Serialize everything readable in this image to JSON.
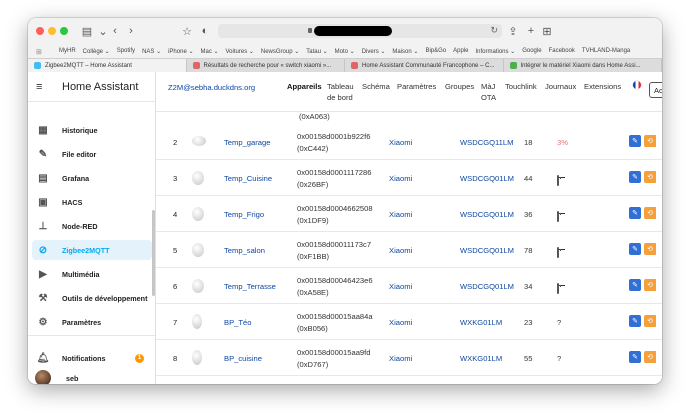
{
  "browser": {
    "bookmarks": [
      "MyHR",
      "Collège ⌄",
      "Spotify",
      "NAS ⌄",
      "iPhone ⌄",
      "Mac ⌄",
      "Voitures ⌄",
      "NewsGroup ⌄",
      "Tatau ⌄",
      "Moto ⌄",
      "Divers ⌄",
      "Maison ⌄",
      "Bip&Go",
      "Apple",
      "Informations ⌄",
      "Google",
      "Facebook",
      "TVHLAND-Manga"
    ],
    "tabs": [
      {
        "label": "Zigbee2MQTT – Home Assistant",
        "color": "#41bdf5"
      },
      {
        "label": "Résultats de recherche pour « switch xiaomi »...",
        "color": "#e06666"
      },
      {
        "label": "Home Assistant Communauté Francophone – C...",
        "color": "#e06666"
      },
      {
        "label": "Intégrer le matériel Xiaomi dans Home Assi...",
        "color": "#4caf50"
      }
    ]
  },
  "sidebar": {
    "title": "Home Assistant",
    "items": [
      {
        "label": "Historique",
        "icon": "history-icon"
      },
      {
        "label": "File editor",
        "icon": "wrench-icon"
      },
      {
        "label": "Grafana",
        "icon": "chart-icon"
      },
      {
        "label": "HACS",
        "icon": "hacs-icon"
      },
      {
        "label": "Node-RED",
        "icon": "sitemap-icon"
      },
      {
        "label": "Zigbee2MQTT",
        "icon": "zigbee-icon"
      },
      {
        "label": "Multimédia",
        "icon": "media-icon"
      },
      {
        "label": "Outils de développement",
        "icon": "hammer-icon"
      },
      {
        "label": "Paramètres",
        "icon": "gear-icon"
      }
    ],
    "notifications": {
      "label": "Notifications",
      "count": "1"
    },
    "user": {
      "label": "seb"
    }
  },
  "topbar": {
    "host": "Z2M@sebha.duckdns.org",
    "nav": [
      "Appareils",
      "Tableau de bord",
      "Schéma",
      "Paramètres",
      "Groupes",
      "MàJ OTA",
      "Touchlink",
      "Journaux",
      "Extensions"
    ],
    "active_nav": "Appareils",
    "button_label": "Activer l'ap"
  },
  "table": {
    "partial_text": "(0xA063)",
    "rows": [
      {
        "num": "2",
        "name": "Temp_garage",
        "ieee": "0x00158d0001b922f6",
        "nwk": "(0xC442)",
        "vendor": "Xiaomi",
        "model": "WSDCGQ11LM",
        "lqi": "18",
        "battery": "3%",
        "battery_level": 0.03
      },
      {
        "num": "3",
        "name": "Temp_Cuisine",
        "ieee": "0x00158d0001117286",
        "nwk": "(0x26BF)",
        "vendor": "Xiaomi",
        "model": "WSDCGQ01LM",
        "lqi": "44",
        "battery": "",
        "battery_level": 0.8
      },
      {
        "num": "4",
        "name": "Temp_Frigo",
        "ieee": "0x00158d0004662508",
        "nwk": "(0x1DF9)",
        "vendor": "Xiaomi",
        "model": "WSDCGQ01LM",
        "lqi": "36",
        "battery": "",
        "battery_level": 0.8
      },
      {
        "num": "5",
        "name": "Temp_salon",
        "ieee": "0x00158d00011173c7",
        "nwk": "(0xF1BB)",
        "vendor": "Xiaomi",
        "model": "WSDCGQ01LM",
        "lqi": "78",
        "battery": "",
        "battery_level": 0.8
      },
      {
        "num": "6",
        "name": "Temp_Terrasse",
        "ieee": "0x00158d00046423e6",
        "nwk": "(0xA58E)",
        "vendor": "Xiaomi",
        "model": "WSDCGQ01LM",
        "lqi": "34",
        "battery": "",
        "battery_level": 0.8
      },
      {
        "num": "7",
        "name": "BP_Téo",
        "ieee": "0x00158d00015aa84a",
        "nwk": "(0xB056)",
        "vendor": "Xiaomi",
        "model": "WXKG01LM",
        "lqi": "23",
        "battery": "?",
        "battery_level": null
      },
      {
        "num": "8",
        "name": "BP_cuisine",
        "ieee": "0x00158d00015aa9fd",
        "nwk": "(0xD767)",
        "vendor": "Xiaomi",
        "model": "WXKG01LM",
        "lqi": "55",
        "battery": "?",
        "battery_level": null
      }
    ]
  }
}
